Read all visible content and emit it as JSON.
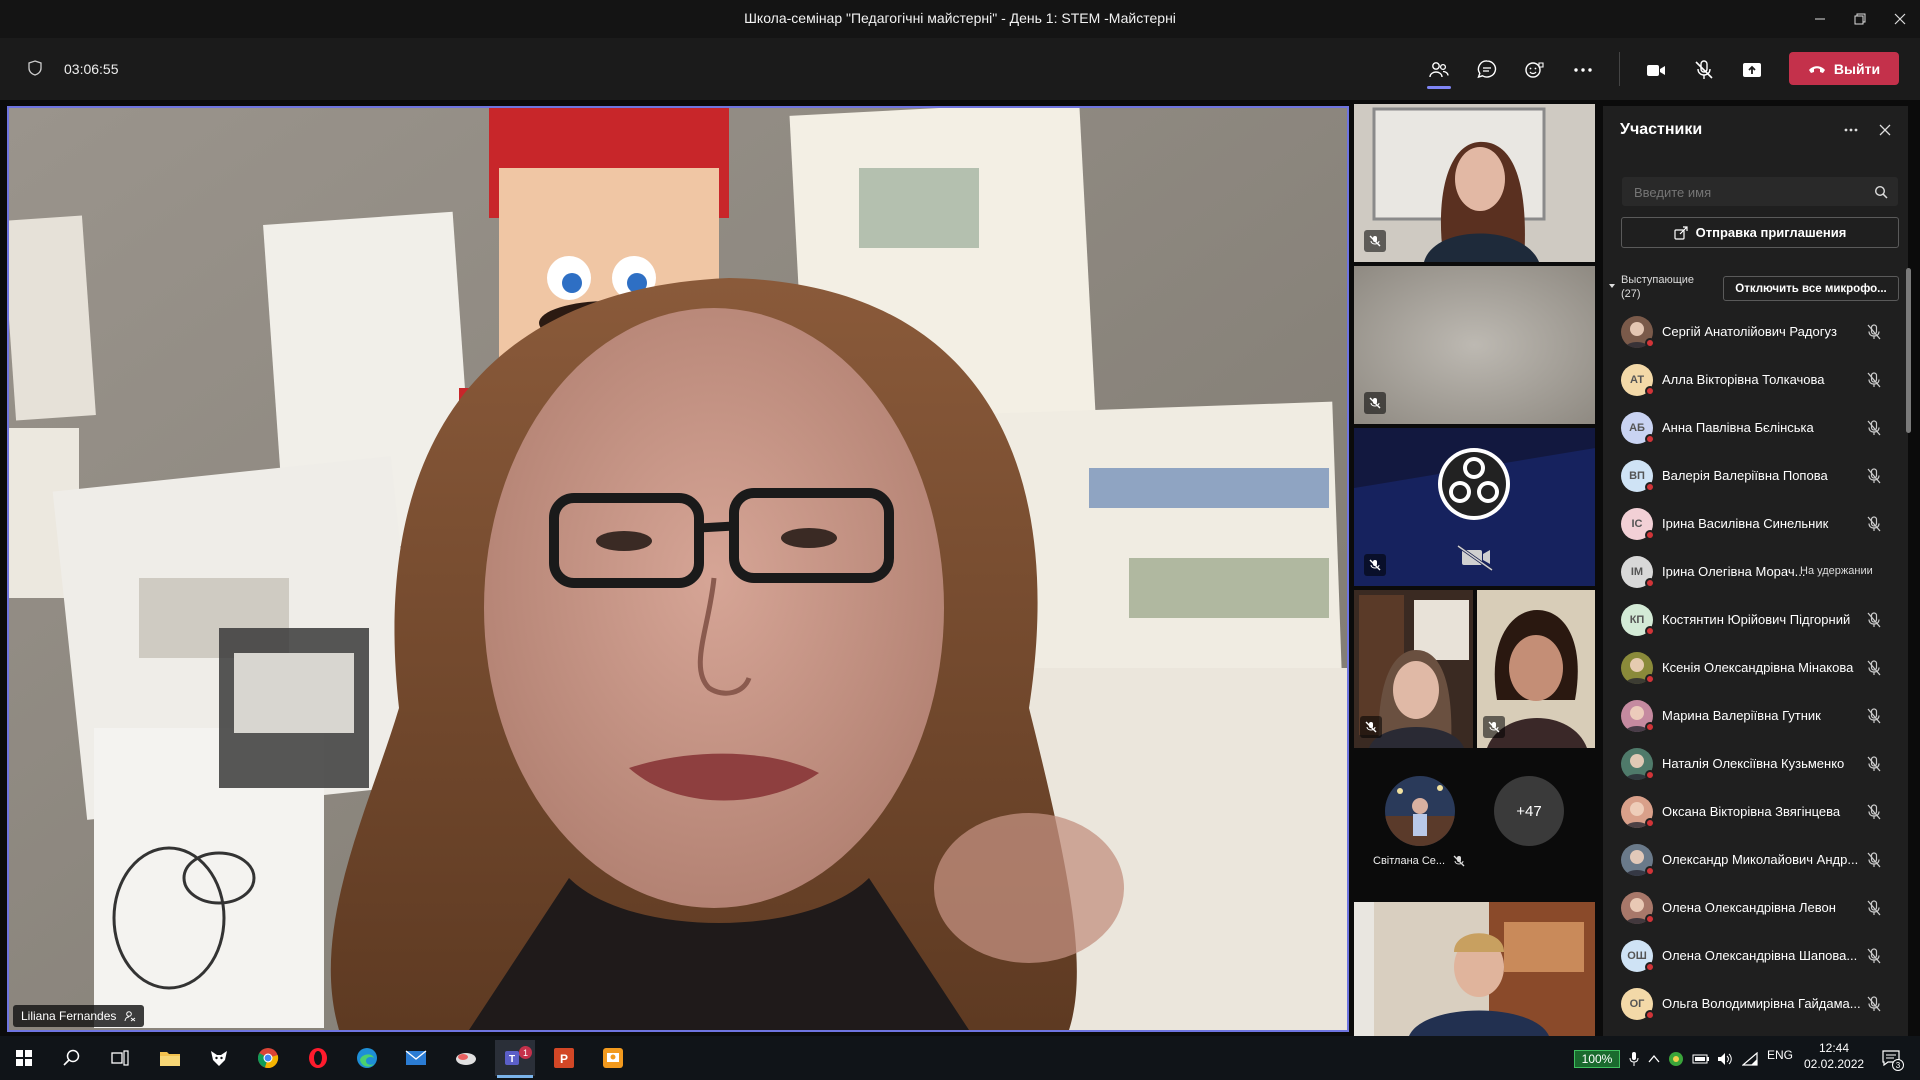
{
  "window": {
    "title": "Школа-семінар \"Педагогічні майстерні\" - День 1: STEM -Майстерні"
  },
  "toolbar": {
    "timer": "03:06:55",
    "leave_label": "Выйти"
  },
  "stage": {
    "presenter_name": "Liliana Fernandes"
  },
  "gallery": {
    "small_tile_name": "Світлана Се...",
    "overflow_count": "+47"
  },
  "panel": {
    "title": "Участники",
    "search_placeholder": "Введите имя",
    "invite_label": "Отправка приглашения",
    "section_label": "Выступающие",
    "section_count": "(27)",
    "mute_all_label": "Отключить все микрофо..."
  },
  "participants": [
    {
      "name": "Сергій Анатолійович Радогуз",
      "initials": "",
      "photo": true,
      "avatar_color": "#7a5a4a"
    },
    {
      "name": "Алла Вікторівна Толкачова",
      "initials": "АТ",
      "photo": false,
      "avatar_color": "#f3d9a8"
    },
    {
      "name": "Анна Павлівна Бєлінська",
      "initials": "АБ",
      "photo": false,
      "avatar_color": "#c9d3f2"
    },
    {
      "name": "Валерія Валеріївна Попова",
      "initials": "ВП",
      "photo": false,
      "avatar_color": "#cfe3f5"
    },
    {
      "name": "Ірина Василівна Синельник",
      "initials": "ІС",
      "photo": false,
      "avatar_color": "#f2d0d6"
    },
    {
      "name": "Ірина Олегівна Морач...",
      "initials": "ІМ",
      "photo": false,
      "avatar_color": "#d8d8d8",
      "status": "На удержании"
    },
    {
      "name": "Костянтин Юрійович Підгорний",
      "initials": "КП",
      "photo": false,
      "avatar_color": "#d3ead6"
    },
    {
      "name": "Ксенія Олександрівна Мінакова",
      "initials": "",
      "photo": true,
      "avatar_color": "#8a8a3a"
    },
    {
      "name": "Марина Валеріївна Гутник",
      "initials": "",
      "photo": true,
      "avatar_color": "#c58aa0"
    },
    {
      "name": "Наталія Олексіївна Кузьменко",
      "initials": "",
      "photo": true,
      "avatar_color": "#4f7a6a"
    },
    {
      "name": "Оксана Вікторівна Звягінцева",
      "initials": "",
      "photo": true,
      "avatar_color": "#d9a08a"
    },
    {
      "name": "Олександр Миколайович Андр...",
      "initials": "",
      "photo": true,
      "avatar_color": "#6a7a8a"
    },
    {
      "name": "Олена Олександрівна Левон",
      "initials": "",
      "photo": true,
      "avatar_color": "#a8786a"
    },
    {
      "name": "Олена Олександрівна Шапова...",
      "initials": "ОШ",
      "photo": false,
      "avatar_color": "#cfe3f5"
    },
    {
      "name": "Ольга Володимирівна Гайдама...",
      "initials": "ОГ",
      "photo": false,
      "avatar_color": "#f3d9a8"
    }
  ],
  "taskbar": {
    "battery": "100%",
    "language": "ENG",
    "time": "12:44",
    "date": "02.02.2022",
    "notification_count": "3",
    "teams_badge": "1"
  },
  "colors": {
    "accent": "#6f75e0",
    "leave_red": "#c4314b",
    "panel_bg": "#1f1f1f"
  }
}
